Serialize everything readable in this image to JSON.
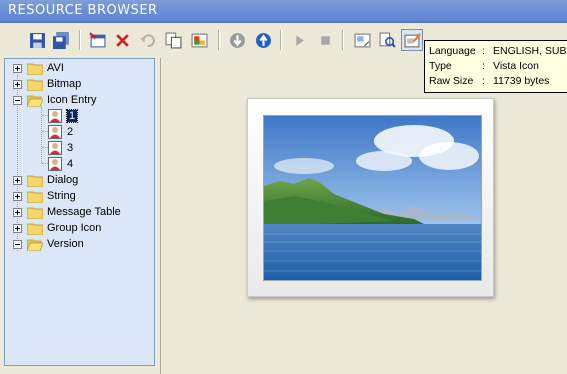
{
  "window": {
    "title": "RESOURCE BROWSER"
  },
  "toolbar": {
    "buttons": [
      {
        "name": "save-icon",
        "pressed": false
      },
      {
        "name": "save-all-icon",
        "pressed": false
      },
      {
        "name": "new-resource-icon",
        "pressed": false
      },
      {
        "name": "delete-icon",
        "pressed": false
      },
      {
        "name": "undo-icon",
        "pressed": false
      },
      {
        "name": "copy-icon",
        "pressed": false
      },
      {
        "name": "properties-icon",
        "pressed": false
      },
      {
        "name": "download-icon",
        "pressed": false
      },
      {
        "name": "upload-icon",
        "pressed": false
      },
      {
        "name": "play-icon",
        "pressed": false
      },
      {
        "name": "stop-icon",
        "pressed": false
      },
      {
        "name": "view-icon",
        "pressed": false
      },
      {
        "name": "find-icon",
        "pressed": false
      },
      {
        "name": "info-icon",
        "pressed": true
      }
    ]
  },
  "tree": {
    "items": [
      {
        "label": "AVI",
        "expanded": false
      },
      {
        "label": "Bitmap",
        "expanded": false
      },
      {
        "label": "Icon Entry",
        "expanded": true,
        "children": [
          {
            "label": "1",
            "selected": true
          },
          {
            "label": "2",
            "selected": false
          },
          {
            "label": "3",
            "selected": false
          },
          {
            "label": "4",
            "selected": false
          }
        ]
      },
      {
        "label": "Dialog",
        "expanded": false
      },
      {
        "label": "String",
        "expanded": false
      },
      {
        "label": "Message Table",
        "expanded": false
      },
      {
        "label": "Group Icon",
        "expanded": false
      },
      {
        "label": "Version",
        "expanded": true
      }
    ]
  },
  "tooltip": {
    "rows": [
      {
        "key": "Language",
        "sep": ":",
        "value": "ENGLISH, SUB"
      },
      {
        "key": "Type",
        "sep": ":",
        "value": "Vista Icon"
      },
      {
        "key": "Raw Size",
        "sep": ":",
        "value": "11739 bytes"
      }
    ]
  }
}
